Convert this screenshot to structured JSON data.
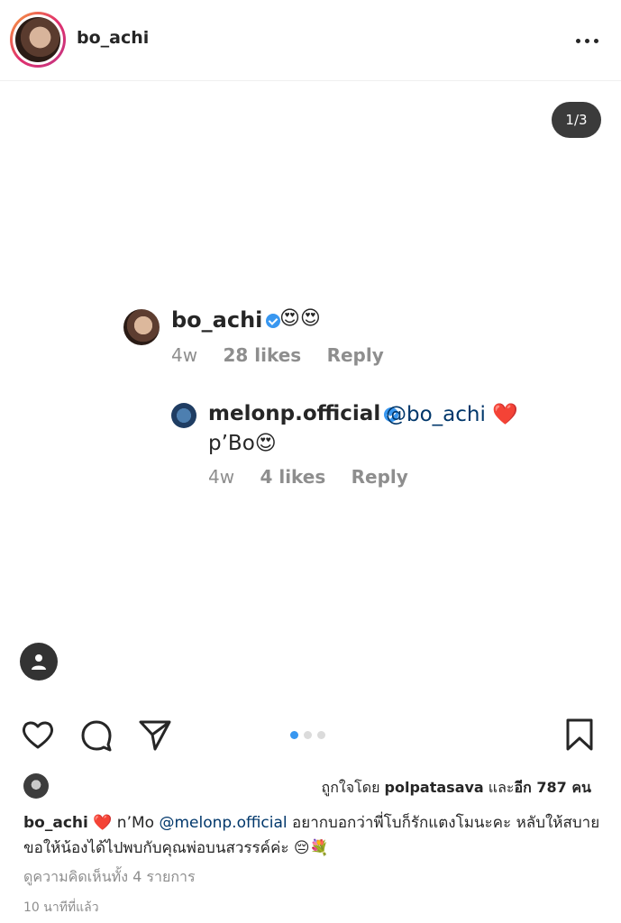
{
  "header": {
    "username": "bo_achi",
    "more_icon": "more-horizontal-icon"
  },
  "media": {
    "counter": "1/3",
    "comment": {
      "username": "bo_achi",
      "emoji": "😍😍",
      "time": "4w",
      "likes": "28 likes",
      "reply_label": "Reply"
    },
    "reply": {
      "username": "melonp.official",
      "mention": "@bo_achi",
      "heart": "❤️",
      "text": "p’Bo😍",
      "time": "4w",
      "likes": "4 likes",
      "reply_label": "Reply"
    },
    "user_tag_icon": "person-icon"
  },
  "actions": {
    "icons": [
      "heart-icon",
      "comment-icon",
      "share-icon",
      "bookmark-icon"
    ],
    "carousel_total": 3,
    "carousel_active": 1,
    "accent_color": "#3897f0"
  },
  "likes": {
    "prefix": "ถูกใจโดย ",
    "user": "polpatasava",
    "middle": " และ",
    "count": "อีก 787 คน"
  },
  "caption": {
    "username": "bo_achi",
    "heart": "❤️",
    "pre": " n’Mo ",
    "mention": "@melonp.official",
    "text": " อยากบอกว่าพี่โบก็รักแตงโมนะคะ หลับให้สบาย ขอให้น้องได้ไปพบกับคุณพ่อบนสวรรค์ค่ะ 😔💐"
  },
  "view_comments": "ดูความคิดเห็นทั้ง 4 รายการ",
  "timestamp": "10 นาทีที่แล้ว"
}
